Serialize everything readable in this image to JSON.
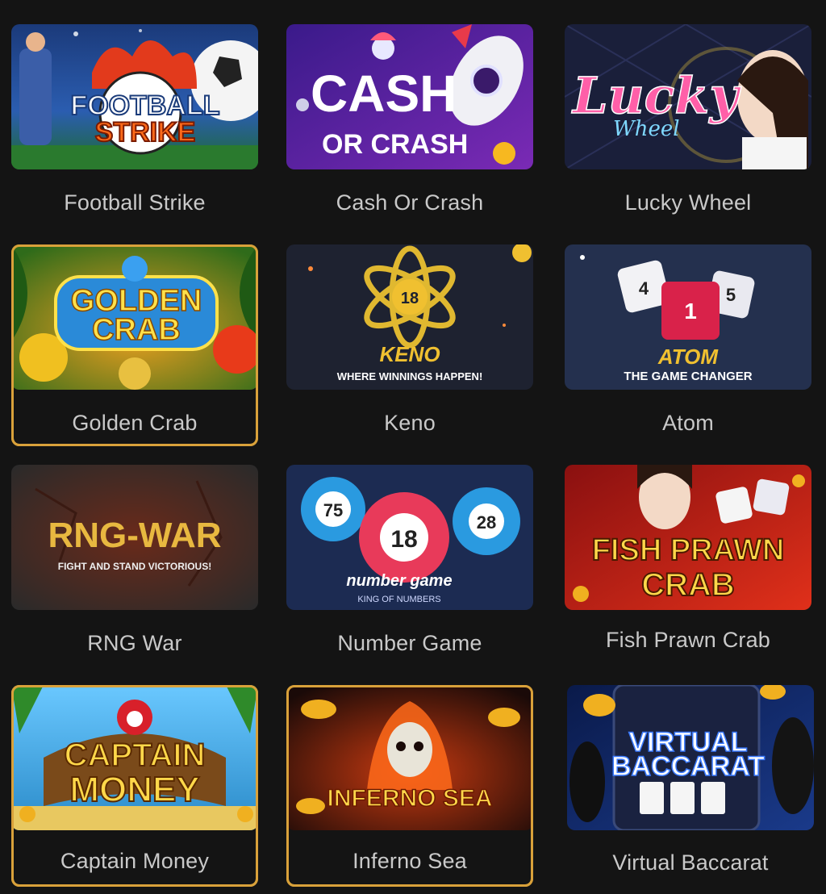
{
  "games": [
    {
      "name": "Football Strike",
      "art": [
        "FOOTBALL",
        "STRIKE"
      ]
    },
    {
      "name": "Cash Or Crash",
      "art": [
        "CASH",
        "OR CRASH"
      ]
    },
    {
      "name": "Lucky Wheel",
      "art": [
        "Lucky",
        "Wheel"
      ]
    },
    {
      "name": "Golden Crab",
      "art": [
        "GOLDEN",
        "CRAB"
      ]
    },
    {
      "name": "Keno",
      "art": [
        "KENO",
        "WHERE WINNINGS HAPPEN!",
        "18"
      ]
    },
    {
      "name": "Atom",
      "art": [
        "ATOM",
        "THE GAME CHANGER",
        "1",
        "4",
        "5"
      ]
    },
    {
      "name": "RNG War",
      "art": [
        "RNG-WAR",
        "FIGHT AND STAND VICTORIOUS!"
      ]
    },
    {
      "name": "Number Game",
      "art": [
        "number game",
        "KING OF NUMBERS",
        "75",
        "18",
        "28"
      ]
    },
    {
      "name": "Fish Prawn Crab",
      "art": [
        "FISH PRAWN",
        "CRAB"
      ]
    },
    {
      "name": "Captain Money",
      "art": [
        "CAPTAIN",
        "MONEY"
      ]
    },
    {
      "name": "Inferno Sea",
      "art": [
        "INFERNO SEA"
      ]
    },
    {
      "name": "Virtual Baccarat",
      "art": [
        "VIRTUAL",
        "BACCARAT"
      ]
    }
  ],
  "colors": {
    "background": "#141414",
    "label": "#c9c9c9",
    "gold_border": "#d9a13a"
  }
}
